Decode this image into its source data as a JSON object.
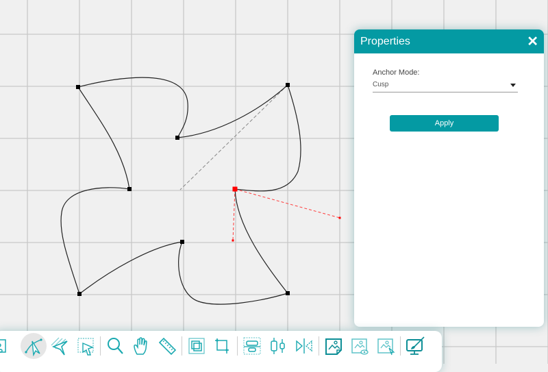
{
  "canvas": {
    "grid_color": "#c8c8c8",
    "background": "#f0f0f0",
    "path_color": "#222222",
    "selected_color": "#ff0000",
    "anchors": [
      {
        "name": "anchor-top-left",
        "selected": false
      },
      {
        "name": "anchor-top-right",
        "selected": false
      },
      {
        "name": "anchor-inner-top",
        "selected": false
      },
      {
        "name": "anchor-inner-left",
        "selected": false
      },
      {
        "name": "anchor-inner-right",
        "selected": true
      },
      {
        "name": "anchor-inner-bottom",
        "selected": false
      },
      {
        "name": "anchor-bottom-left",
        "selected": false
      },
      {
        "name": "anchor-bottom-right",
        "selected": false
      }
    ]
  },
  "properties_panel": {
    "title": "Properties",
    "close_icon": "close-icon",
    "anchor_mode_label": "Anchor Mode:",
    "anchor_mode_value": "Cusp",
    "apply_label": "Apply",
    "accent": "#049aa3"
  },
  "toolbar": {
    "accent": "#1aa9b0",
    "tools": [
      {
        "name": "node-edit-tool",
        "icon": "node-box-icon",
        "active": false
      },
      {
        "name": "pen-tool",
        "icon": "pen-nodes-icon",
        "active": true
      },
      {
        "name": "hatch-select-tool",
        "icon": "hatch-cursor-icon",
        "active": false
      },
      {
        "name": "area-select-tool",
        "icon": "area-cursor-icon",
        "active": false
      },
      {
        "sep": true
      },
      {
        "name": "zoom-tool",
        "icon": "magnifier-icon",
        "active": false
      },
      {
        "name": "pan-tool",
        "icon": "hand-icon",
        "active": false
      },
      {
        "name": "measure-tool",
        "icon": "ruler-icon",
        "active": false
      },
      {
        "sep": true
      },
      {
        "name": "bounding-box-tool",
        "icon": "overlap-box-icon",
        "active": false
      },
      {
        "name": "crop-tool",
        "icon": "crop-icon",
        "active": false
      },
      {
        "sep": true
      },
      {
        "name": "align-center-tool",
        "icon": "align-horizontal-icon",
        "active": false
      },
      {
        "name": "distribute-tool",
        "icon": "distribute-vertical-icon",
        "active": false
      },
      {
        "name": "mirror-tool",
        "icon": "mirror-icon",
        "active": false
      },
      {
        "sep": true
      },
      {
        "name": "image-edit-tool",
        "icon": "image-page-icon",
        "active": false
      },
      {
        "name": "image-preview-tool",
        "icon": "image-eye-icon",
        "active": false
      },
      {
        "name": "image-select-tool",
        "icon": "image-cursor-icon",
        "active": false
      },
      {
        "sep": true
      },
      {
        "name": "paint-screen-tool",
        "icon": "monitor-brush-icon",
        "active": false
      }
    ]
  }
}
